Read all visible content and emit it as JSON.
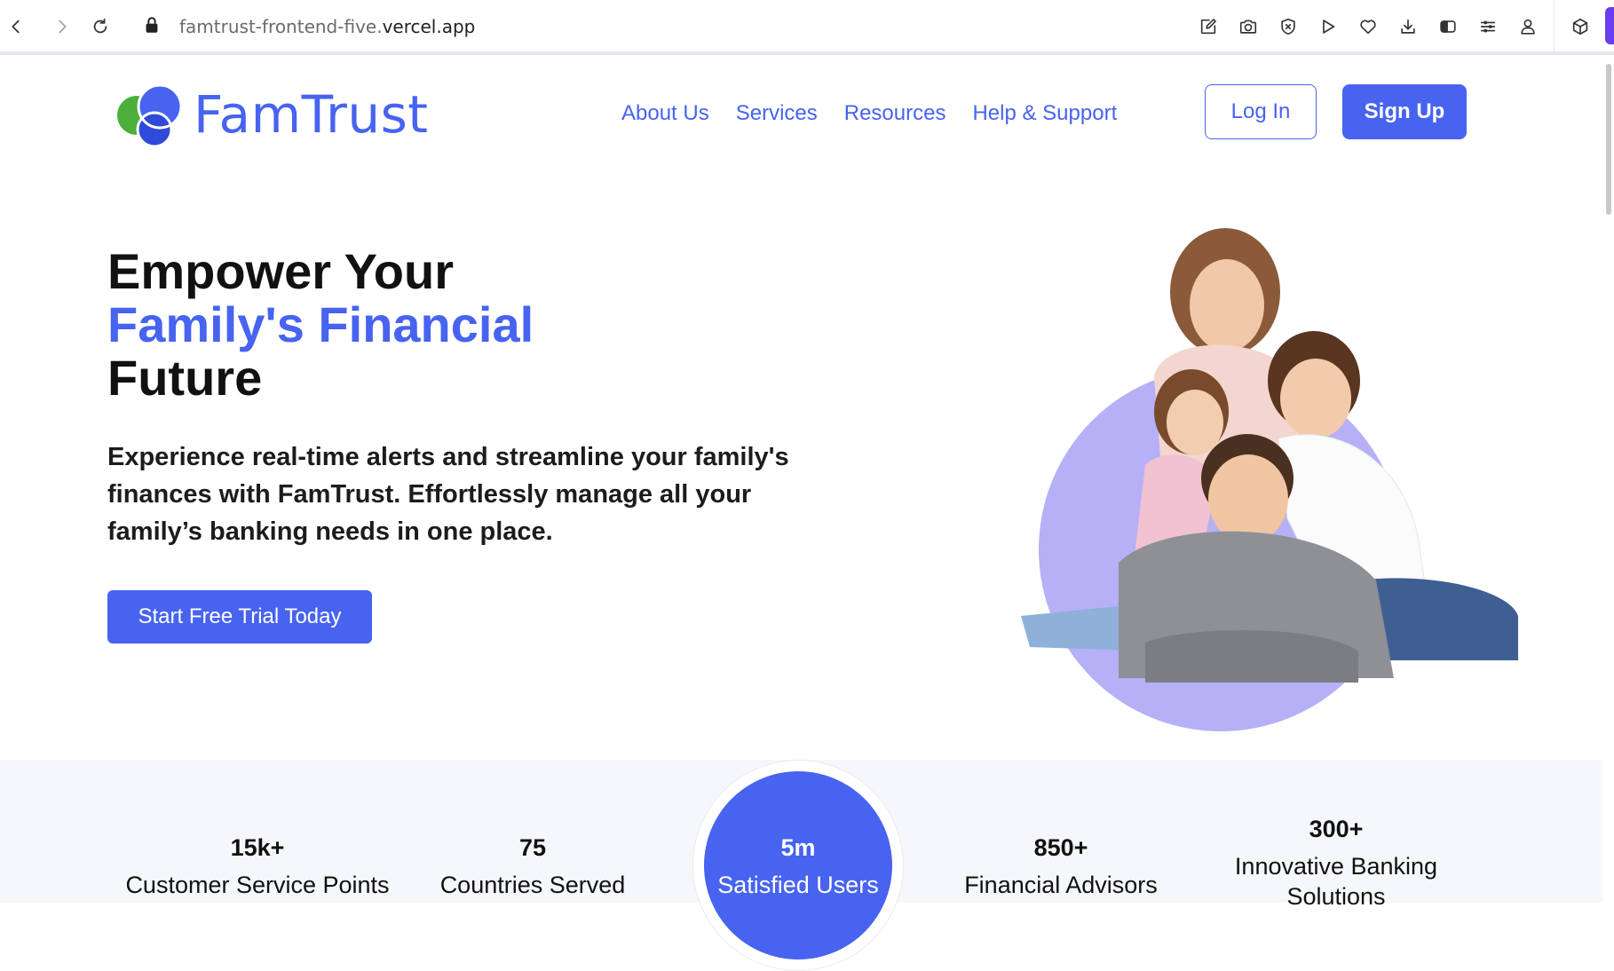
{
  "browser": {
    "url_prefix": "famtrust-frontend-five.",
    "url_host": "vercel.app",
    "toolbar_icons": [
      "edit-icon",
      "camera-icon",
      "shield-x-icon",
      "play-icon",
      "heart-icon",
      "download-icon",
      "sidebar-icon",
      "menu-icon",
      "profile-icon"
    ],
    "extension_icon": "box-icon"
  },
  "header": {
    "logo_text": "FamTrust",
    "nav": [
      "About Us",
      "Services",
      "Resources",
      "Help & Support"
    ],
    "login_label": "Log In",
    "signup_label": "Sign Up"
  },
  "hero": {
    "title_line1": "Empower Your",
    "title_line2": "Family's Financial",
    "title_line3": "Future",
    "description": "Experience real-time alerts and streamline your family's finances with FamTrust. Effortlessly manage all your family’s banking needs in one place.",
    "cta_label": "Start Free Trial Today"
  },
  "stats": [
    {
      "value": "15k+",
      "label": "Customer Service Points"
    },
    {
      "value": "75",
      "label": "Countries Served"
    },
    {
      "value": "5m",
      "label": "Satisfied Users"
    },
    {
      "value": "850+",
      "label": "Financial Advisors"
    },
    {
      "value": "300+",
      "label": "Innovative Banking Solutions"
    }
  ],
  "colors": {
    "brand": "#4763f0",
    "hero_circle": "#b6b0f7",
    "stats_band": "#f5f7fb"
  }
}
